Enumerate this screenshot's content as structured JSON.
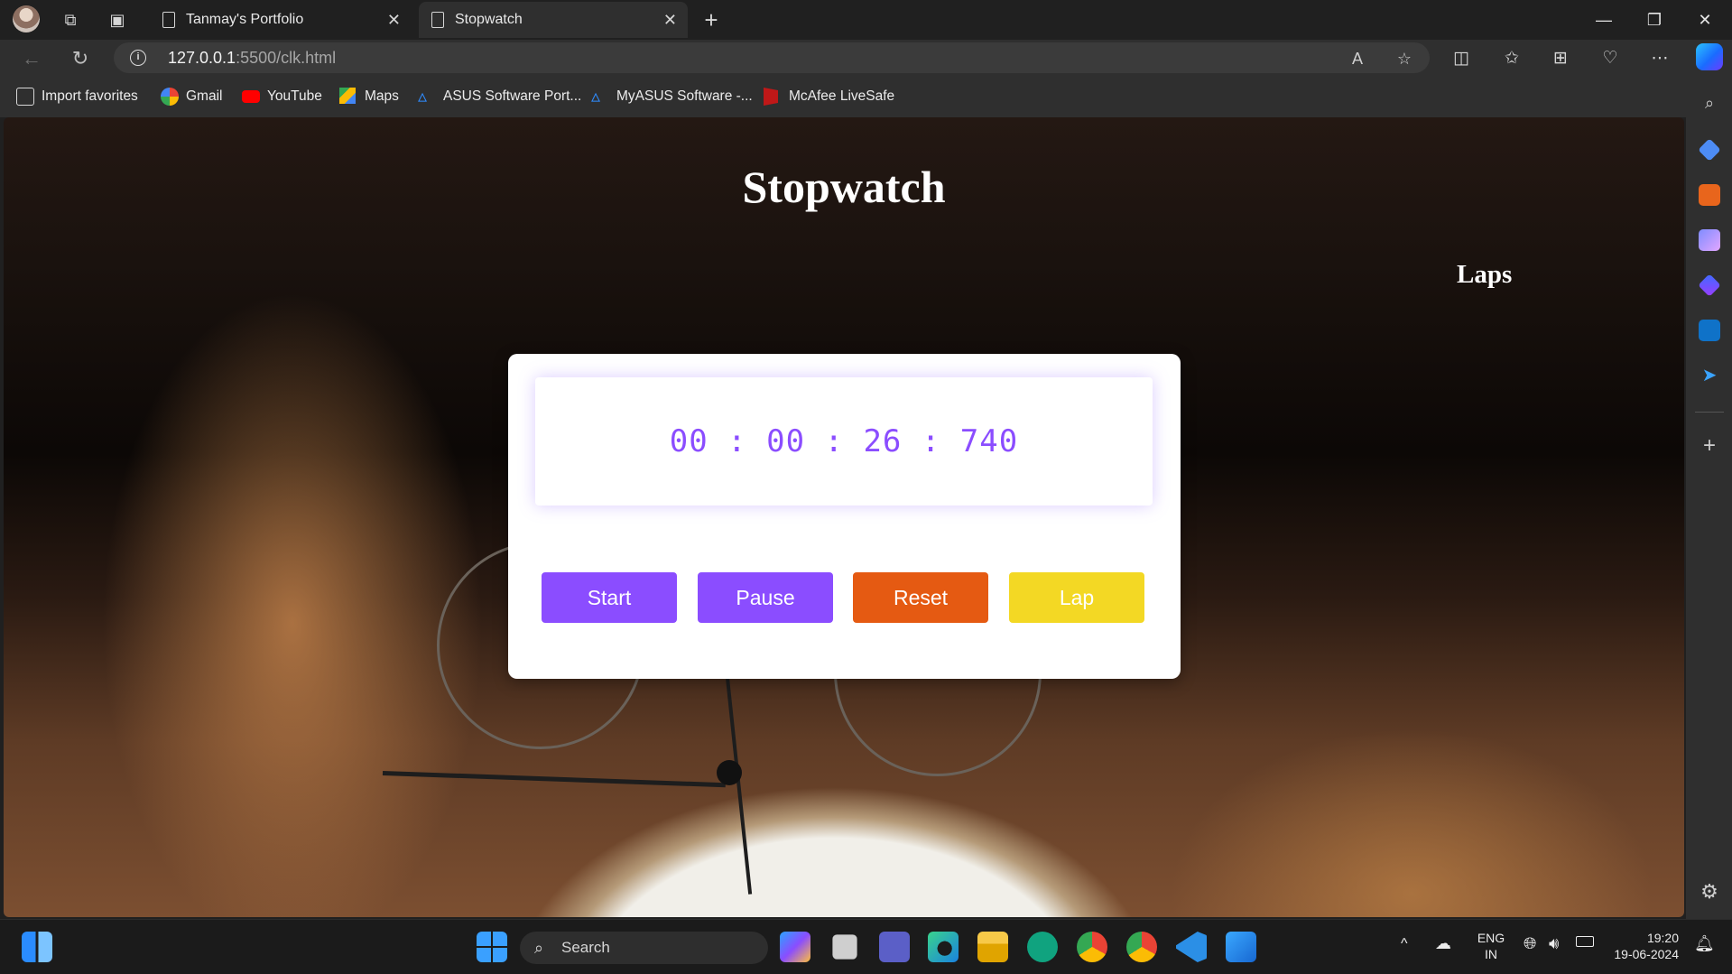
{
  "browser": {
    "tabs": [
      {
        "title": "Tanmay's Portfolio",
        "close": "✕"
      },
      {
        "title": "Stopwatch",
        "close": "✕"
      }
    ],
    "new_tab": "+",
    "window_controls": {
      "minimize": "—",
      "restore": "❐",
      "close": "✕"
    },
    "url": {
      "host": "127.0.0.1",
      "rest": ":5500/clk.html"
    },
    "favorites": [
      {
        "label": "Import favorites",
        "icon": "import-icon"
      },
      {
        "label": "Gmail",
        "icon": "google-icon"
      },
      {
        "label": "YouTube",
        "icon": "youtube-icon"
      },
      {
        "label": "Maps",
        "icon": "maps-icon"
      },
      {
        "label": "ASUS Software Port...",
        "icon": "asus-icon"
      },
      {
        "label": "MyASUS Software -...",
        "icon": "asus-icon"
      },
      {
        "label": "McAfee LiveSafe",
        "icon": "mcafee-icon"
      }
    ]
  },
  "page": {
    "title": "Stopwatch",
    "laps_heading": "Laps",
    "time": "00 : 00 : 26 : 740",
    "buttons": {
      "start": "Start",
      "pause": "Pause",
      "reset": "Reset",
      "lap": "Lap"
    },
    "colors": {
      "accent": "#8b4dff",
      "reset": "#e55a12",
      "lap": "#f3d824"
    }
  },
  "taskbar": {
    "search_placeholder": "Search",
    "language": {
      "line1": "ENG",
      "line2": "IN"
    },
    "clock": {
      "time": "19:20",
      "date": "19-06-2024"
    }
  }
}
